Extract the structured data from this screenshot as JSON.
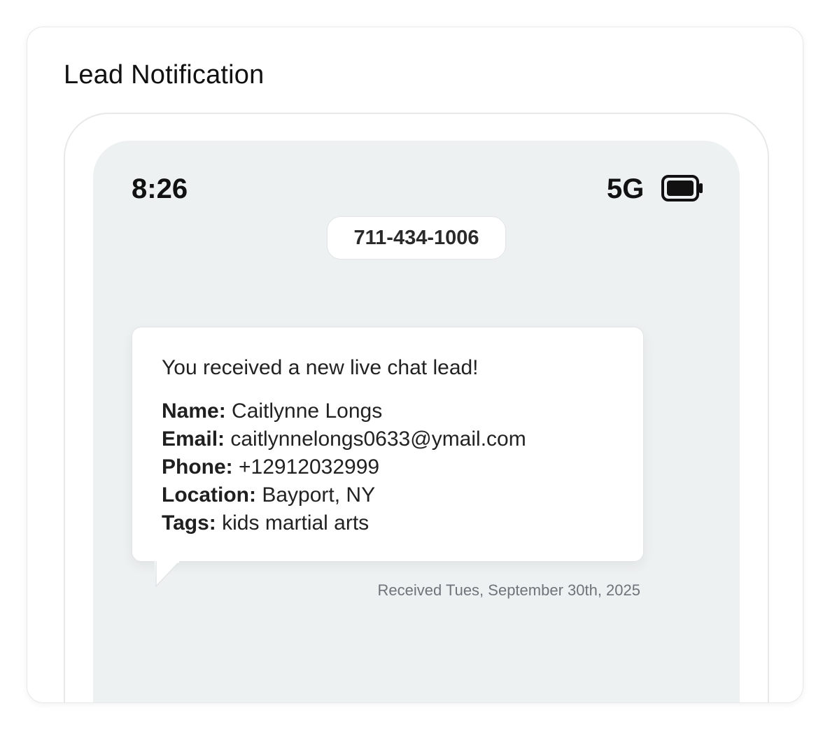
{
  "card": {
    "title": "Lead Notification"
  },
  "status_bar": {
    "time": "8:26",
    "network": "5G",
    "battery_icon": "battery-full-icon"
  },
  "sender": {
    "phone": "711-434-1006"
  },
  "message": {
    "intro": "You received a new live chat lead!",
    "fields": [
      {
        "label": "Name:",
        "value": "Caitlynne Longs"
      },
      {
        "label": "Email:",
        "value": "caitlynnelongs0633@ymail.com"
      },
      {
        "label": "Phone:",
        "value": "+12912032999"
      },
      {
        "label": "Location:",
        "value": "Bayport, NY"
      },
      {
        "label": "Tags:",
        "value": "kids martial arts"
      }
    ],
    "received": "Received Tues, September 30th, 2025"
  },
  "colors": {
    "screen_bg": "#eef1f2",
    "bubble_bg": "#ffffff",
    "text": "#222222",
    "muted": "#6e7479"
  }
}
